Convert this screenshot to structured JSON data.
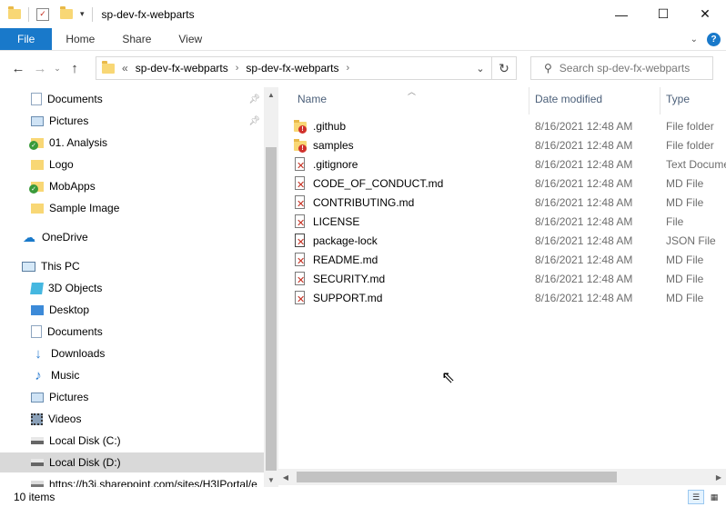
{
  "window": {
    "title": "sp-dev-fx-webparts"
  },
  "window_controls": {
    "minimize": "—",
    "maximize": "☐",
    "close": "✕"
  },
  "ribbon": {
    "tabs": [
      "File",
      "Home",
      "Share",
      "View"
    ]
  },
  "address": {
    "overflow": "«",
    "crumbs": [
      "sp-dev-fx-webparts",
      "sp-dev-fx-webparts"
    ]
  },
  "search": {
    "placeholder": "Search sp-dev-fx-webparts"
  },
  "nav": {
    "quick_access": [
      {
        "label": "Documents",
        "icon": "documents-icon",
        "pinned": true
      },
      {
        "label": "Pictures",
        "icon": "pictures-icon",
        "pinned": true
      },
      {
        "label": "01. Analysis",
        "icon": "synced-folder-icon",
        "pinned": false
      },
      {
        "label": "Logo",
        "icon": "folder-icon",
        "pinned": false
      },
      {
        "label": "MobApps",
        "icon": "synced-folder-icon",
        "pinned": false
      },
      {
        "label": "Sample Image",
        "icon": "folder-icon",
        "pinned": false
      }
    ],
    "onedrive": "OneDrive",
    "this_pc": "This PC",
    "pc_items": [
      {
        "label": "3D Objects",
        "icon": "3d-objects-icon"
      },
      {
        "label": "Desktop",
        "icon": "desktop-icon"
      },
      {
        "label": "Documents",
        "icon": "documents-icon"
      },
      {
        "label": "Downloads",
        "icon": "downloads-icon"
      },
      {
        "label": "Music",
        "icon": "music-icon"
      },
      {
        "label": "Pictures",
        "icon": "pictures-icon"
      },
      {
        "label": "Videos",
        "icon": "videos-icon"
      },
      {
        "label": "Local Disk (C:)",
        "icon": "drive-icon"
      },
      {
        "label": "Local Disk (D:)",
        "icon": "drive-icon"
      },
      {
        "label": "https://h3i.sharepoint.com/sites/H3IPortal/e",
        "icon": "network-drive-icon"
      }
    ]
  },
  "columns": {
    "name": "Name",
    "date": "Date modified",
    "type": "Type"
  },
  "files": [
    {
      "name": ".github",
      "date": "8/16/2021 12:48 AM",
      "type": "File folder",
      "kind": "folder"
    },
    {
      "name": "samples",
      "date": "8/16/2021 12:48 AM",
      "type": "File folder",
      "kind": "folder"
    },
    {
      "name": ".gitignore",
      "date": "8/16/2021 12:48 AM",
      "type": "Text Document",
      "kind": "file"
    },
    {
      "name": "CODE_OF_CONDUCT.md",
      "date": "8/16/2021 12:48 AM",
      "type": "MD File",
      "kind": "file"
    },
    {
      "name": "CONTRIBUTING.md",
      "date": "8/16/2021 12:48 AM",
      "type": "MD File",
      "kind": "file"
    },
    {
      "name": "LICENSE",
      "date": "8/16/2021 12:48 AM",
      "type": "File",
      "kind": "file"
    },
    {
      "name": "package-lock",
      "date": "8/16/2021 12:48 AM",
      "type": "JSON File",
      "kind": "json"
    },
    {
      "name": "README.md",
      "date": "8/16/2021 12:48 AM",
      "type": "MD File",
      "kind": "file"
    },
    {
      "name": "SECURITY.md",
      "date": "8/16/2021 12:48 AM",
      "type": "MD File",
      "kind": "file"
    },
    {
      "name": "SUPPORT.md",
      "date": "8/16/2021 12:48 AM",
      "type": "MD File",
      "kind": "file"
    }
  ],
  "status": {
    "item_count": "10 items"
  },
  "colors": {
    "accent": "#1979ca",
    "selected": "#cce8ff",
    "error": "#d0312d"
  }
}
